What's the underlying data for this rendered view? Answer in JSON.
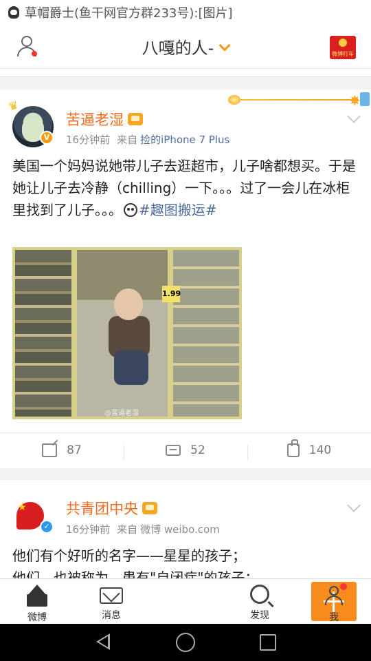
{
  "status_bar": {
    "notification": "草帽爵士(鱼干网官方群233号):[图片]"
  },
  "nav": {
    "title": "八嘎的人-",
    "redpack_label": "微博打车"
  },
  "posts": [
    {
      "author": "苦逼老湿",
      "time": "16分钟前",
      "source_prefix": "来自",
      "source": "捡的iPhone 7 Plus",
      "text_main": "美国一个妈妈说她带儿子去逛超市，儿子啥都想买。于是她让儿子去冷静（chilling）一下。。。过了一会儿在冰柜里找到了儿子。。。",
      "tag": "#趣图搬运#",
      "image_price": "1.99",
      "image_watermark": "@苦逼老湿",
      "shares": "87",
      "comments": "52",
      "likes": "140"
    },
    {
      "author": "共青团中央",
      "time": "16分钟前",
      "source_prefix": "来自",
      "source": "微博 weibo.com",
      "text_line1": "他们有个好听的名字——星星的孩子；",
      "text_line2": "他们，也被称为，患有\"自闭症\"的孩子；"
    }
  ],
  "tabs": [
    {
      "label": "微博",
      "icon": "home-icon"
    },
    {
      "label": "消息",
      "icon": "mail-icon"
    },
    {
      "label": "",
      "icon": "plus-icon"
    },
    {
      "label": "发现",
      "icon": "search-icon"
    },
    {
      "label": "我",
      "icon": "profile-icon"
    }
  ],
  "colors": {
    "accent": "#f78b1e",
    "username": "#f26b1d",
    "link": "#4e6c9c"
  }
}
